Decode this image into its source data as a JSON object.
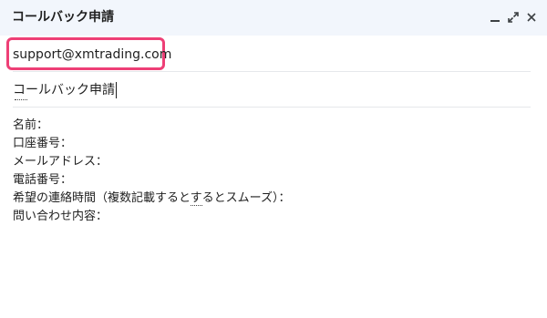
{
  "window": {
    "title": "コールバック申請",
    "controls": {
      "minimize_icon": "minimize-icon",
      "popout_icon": "popout-icon",
      "close_icon": "close-icon"
    }
  },
  "recipient": {
    "email": "support@xmtrading.com",
    "highlight_color": "#ee3f76"
  },
  "subject": {
    "text": "コールバック申請"
  },
  "body": {
    "lines": [
      "名前：",
      "口座番号：",
      "メールアドレス：",
      "電話番号：",
      "希望の連絡時間（複数記載すると",
      "問い合わせ内容："
    ],
    "line5_marked": "す",
    "line5_rest": "るとスムーズ）："
  },
  "colors": {
    "titlebar_bg": "#f2f6fc",
    "text": "#1f1f1f",
    "divider": "#e6e8eb"
  }
}
